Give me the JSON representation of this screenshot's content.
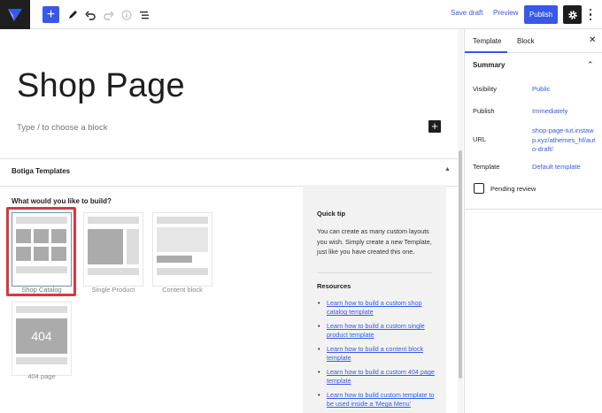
{
  "toolbar": {
    "save_draft": "Save draft",
    "preview": "Preview",
    "publish": "Publish",
    "icons": [
      "wordpress-logo",
      "add",
      "edit",
      "undo",
      "redo",
      "info",
      "list-view",
      "settings",
      "more"
    ]
  },
  "editor": {
    "title": "Shop Page",
    "block_placeholder": "Type / to choose a block"
  },
  "metabox": {
    "title": "Botiga Templates",
    "question": "What would you like to build?",
    "templates": [
      {
        "label": "Shop Catalog",
        "selected": true
      },
      {
        "label": "Single Product",
        "selected": false
      },
      {
        "label": "Content block",
        "selected": false
      },
      {
        "label": "404 page",
        "selected": false,
        "thumb_text": "404"
      }
    ],
    "quick_tip": {
      "title": "Quick tip",
      "text": "You can create as many custom layouts you wish. Simply create a new Template, just like you have created this one.",
      "resources_title": "Resources",
      "resources": [
        "Learn how to build a custom shop catalog template",
        "Learn how to build a custom single product template",
        "Learn how to build a content block template",
        "Learn how to build a custom 404 page template",
        "Learn how to build custom template to be used inside a 'Mega Menu'"
      ]
    }
  },
  "sidebar": {
    "tabs": [
      "Template",
      "Block"
    ],
    "active_tab": "Template",
    "summary": "Summary",
    "rows": [
      {
        "label": "Visibility",
        "value": "Public"
      },
      {
        "label": "Publish",
        "value": "Immediately"
      },
      {
        "label": "URL",
        "value": "shop-page-tut.instawp.xyz/athemes_hf/auto-draft/"
      },
      {
        "label": "Template",
        "value": "Default template"
      }
    ],
    "pending_review": "Pending review"
  },
  "colors": {
    "accent": "#3858e9",
    "highlight": "#d9373e",
    "dark": "#1e1e1e"
  }
}
